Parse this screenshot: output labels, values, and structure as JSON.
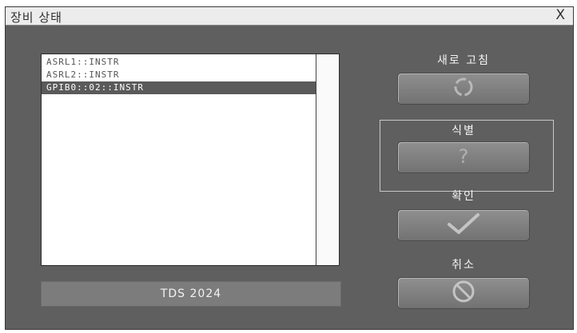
{
  "window": {
    "title": "장비 상태",
    "close_label": "X"
  },
  "device_list": {
    "items": [
      {
        "label": "ASRL1::INSTR",
        "selected": false
      },
      {
        "label": "ASRL2::INSTR",
        "selected": false
      },
      {
        "label": "GPIB0::02::INSTR",
        "selected": true
      }
    ]
  },
  "model_display": {
    "text": "TDS 2024"
  },
  "buttons": {
    "refresh": {
      "label": "새로 고침",
      "icon": "refresh-icon"
    },
    "identify": {
      "label": "식별",
      "icon": "question-mark-icon"
    },
    "ok": {
      "label": "확인",
      "icon": "checkmark-icon"
    },
    "cancel": {
      "label": "취소",
      "icon": "prohibited-icon"
    }
  },
  "colors": {
    "window_bg": "#5f5f5f",
    "selected_row": "#5a5a5a",
    "button_bg": "#828282"
  }
}
